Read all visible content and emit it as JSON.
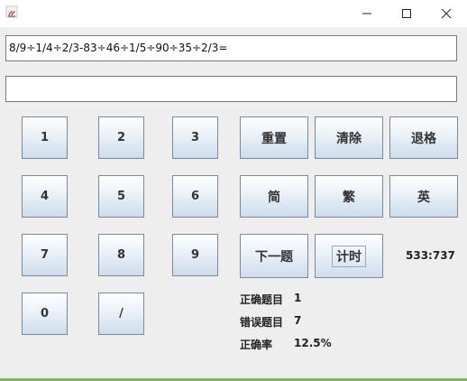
{
  "window": {
    "controls": {
      "minimize": "—",
      "maximize": "☐",
      "close": "✕"
    }
  },
  "question": "8/9÷1/4÷2/3-83÷46÷1/5÷90÷35÷2/3=",
  "answer": {
    "value": "",
    "placeholder": ""
  },
  "keypad": {
    "k1": "1",
    "k2": "2",
    "k3": "3",
    "k4": "4",
    "k5": "5",
    "k6": "6",
    "k7": "7",
    "k8": "8",
    "k9": "9",
    "k0": "0",
    "kslash": "/"
  },
  "commands": {
    "reset": "重置",
    "clear": "清除",
    "backspace": "退格",
    "simplified": "简",
    "traditional": "繁",
    "english": "英",
    "next": "下一题",
    "timer": "计时"
  },
  "timer_display": "533:737",
  "stats": {
    "correct_label": "正确题目",
    "correct_value": "1",
    "wrong_label": "错误题目",
    "wrong_value": "7",
    "rate_label": "正确率",
    "rate_value": "12.5%"
  },
  "colors": {
    "window_bg": "#eeeeee",
    "button_top": "#ffffff",
    "button_bottom": "#cddcec",
    "accent_line": "#7db660"
  }
}
